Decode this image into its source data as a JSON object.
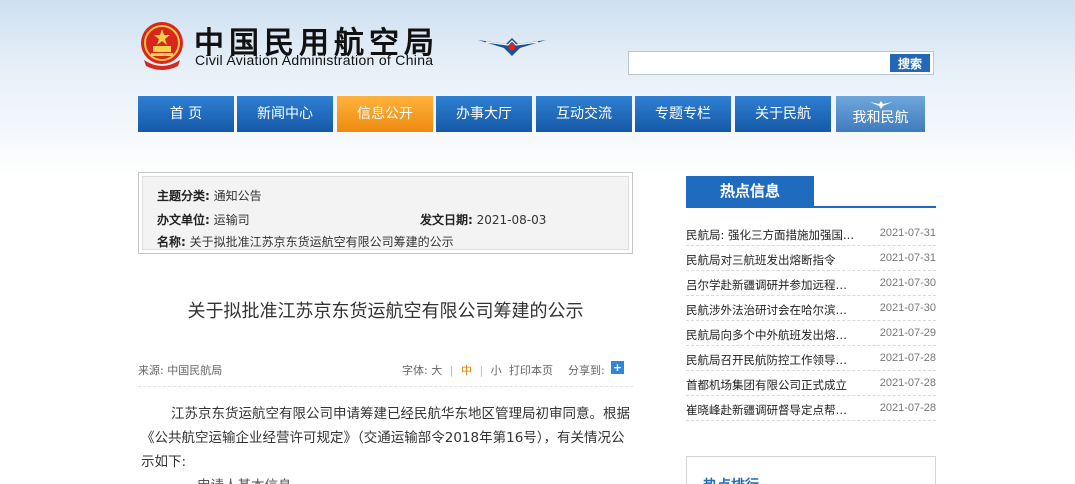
{
  "header": {
    "title_cn": "中国民用航空局",
    "title_en": "Civil Aviation Administration of China",
    "search": {
      "placeholder": "",
      "button_label": "搜索"
    }
  },
  "nav": {
    "items": [
      {
        "label": "首 页"
      },
      {
        "label": "新闻中心"
      },
      {
        "label": "信息公开"
      },
      {
        "label": "办事大厅"
      },
      {
        "label": "互动交流"
      },
      {
        "label": "专题专栏"
      },
      {
        "label": "关于民航"
      },
      {
        "label": "我和民航"
      }
    ],
    "active_index": 2,
    "colors": {
      "normal": "#1d66b8",
      "active": "#f5981f",
      "special": "#5a95d0"
    }
  },
  "info": {
    "subject_label": "主题分类:",
    "subject_value": "通知公告",
    "dept_label": "办文单位:",
    "dept_value": "运输司",
    "date_label": "发文日期:",
    "date_value": "2021-08-03",
    "name_label": "名称:",
    "name_value": "关于拟批准江苏京东货运航空有限公司筹建的公示"
  },
  "article": {
    "title": "关于拟批准江苏京东货运航空有限公司筹建的公示",
    "source": "来源: 中国民航局",
    "font_label": "字体:",
    "font_large": "大",
    "font_medium": "中",
    "font_small": "小",
    "sep": "|",
    "print_label": "打印本页",
    "share_label": "分享到:",
    "share_icon": "plus-icon",
    "body": "江苏京东货运航空有限公司申请筹建已经民航华东地区管理局初审同意。根据《公共航空运输企业经营许可规定》（交通运输部令2018年第16号），有关情况公示如下:",
    "body_cut": "一、申请人基本信息"
  },
  "hot": {
    "title": "热点信息",
    "items": [
      {
        "text": "民航局: 强化三方面措施加强国...",
        "date": "2021-07-31"
      },
      {
        "text": "民航局对三航班发出熔断指令",
        "date": "2021-07-31"
      },
      {
        "text": "吕尔学赴新疆调研并参加远程塔...",
        "date": "2021-07-30"
      },
      {
        "text": "民航涉外法治研讨会在哈尔滨举办",
        "date": "2021-07-30"
      },
      {
        "text": "民航局向多个中外航班发出熔断...",
        "date": "2021-07-29"
      },
      {
        "text": "民航局召开民航防控工作领导小...",
        "date": "2021-07-28"
      },
      {
        "text": "首都机场集团有限公司正式成立",
        "date": "2021-07-28"
      },
      {
        "text": "崔晓峰赴新疆调研督导定点帮扶...",
        "date": "2021-07-28"
      }
    ],
    "bottom_title": "热点排行"
  }
}
